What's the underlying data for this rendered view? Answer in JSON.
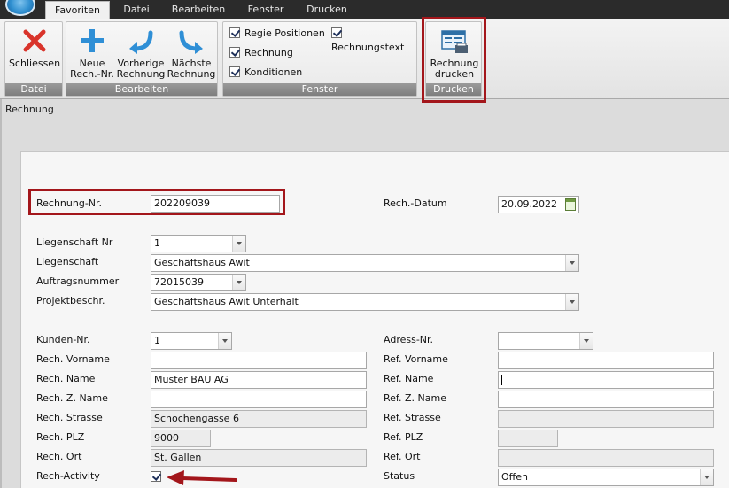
{
  "tabs": [
    "Favoriten",
    "Datei",
    "Bearbeiten",
    "Fenster",
    "Drucken"
  ],
  "ribbon": {
    "groups": {
      "datei": "Datei",
      "bearbeiten": "Bearbeiten",
      "fenster": "Fenster",
      "drucken": "Drucken"
    },
    "buttons": {
      "schliessen": "Schliessen",
      "neue_l1": "Neue",
      "neue_l2": "Rech.-Nr.",
      "vorherige_l1": "Vorherige",
      "vorherige_l2": "Rechnung",
      "naechste_l1": "Nächste",
      "naechste_l2": "Rechnung",
      "drucken_l1": "Rechnung",
      "drucken_l2": "drucken"
    },
    "checkboxes": {
      "regie": {
        "label": "Regie Positionen",
        "checked": true
      },
      "rechnungstext": {
        "label": "Rechnungstext",
        "checked": true
      },
      "rechnung": {
        "label": "Rechnung",
        "checked": true
      },
      "konditionen": {
        "label": "Konditionen",
        "checked": true
      }
    }
  },
  "breadcrumb": "Rechnung",
  "form": {
    "rechnung_nr": {
      "label": "Rechnung-Nr.",
      "value": "202209039"
    },
    "rech_datum": {
      "label": "Rech.-Datum",
      "value": "20.09.2022"
    },
    "liegenschaft_nr": {
      "label": "Liegenschaft Nr",
      "value": "1"
    },
    "liegenschaft": {
      "label": "Liegenschaft",
      "value": "Geschäftshaus Awit"
    },
    "auftragsnummer": {
      "label": "Auftragsnummer",
      "value": "72015039"
    },
    "projektbeschr": {
      "label": "Projektbeschr.",
      "value": "Geschäftshaus Awit Unterhalt"
    },
    "kunden_nr": {
      "label": "Kunden-Nr.",
      "value": "1"
    },
    "rech_vorname": {
      "label": "Rech. Vorname",
      "value": ""
    },
    "rech_name": {
      "label": "Rech. Name",
      "value": "Muster BAU AG"
    },
    "rech_z_name": {
      "label": "Rech. Z. Name",
      "value": ""
    },
    "rech_strasse": {
      "label": "Rech. Strasse",
      "value": "Schochengasse 6"
    },
    "rech_plz": {
      "label": "Rech. PLZ",
      "value": "9000"
    },
    "rech_ort": {
      "label": "Rech. Ort",
      "value": "St. Gallen"
    },
    "rech_activity": {
      "label": "Rech-Activity",
      "checked": true
    },
    "adress_nr": {
      "label": "Adress-Nr.",
      "value": ""
    },
    "ref_vorname": {
      "label": "Ref. Vorname",
      "value": ""
    },
    "ref_name": {
      "label": "Ref. Name",
      "value": ""
    },
    "ref_z_name": {
      "label": "Ref. Z. Name",
      "value": ""
    },
    "ref_strasse": {
      "label": "Ref. Strasse",
      "value": ""
    },
    "ref_plz": {
      "label": "Ref. PLZ",
      "value": ""
    },
    "ref_ort": {
      "label": "Ref. Ort",
      "value": ""
    },
    "status": {
      "label": "Status",
      "value": "Offen"
    }
  },
  "colors": {
    "highlight": "#a3161b",
    "ribbon_icon_blue": "#2f8fd6",
    "close_red": "#d9342b"
  },
  "icons": {
    "close": "close-icon",
    "add": "plus-icon",
    "previous": "undo-arrow-icon",
    "next": "redo-arrow-icon",
    "print": "print-invoice-icon",
    "calendar": "calendar-icon"
  }
}
